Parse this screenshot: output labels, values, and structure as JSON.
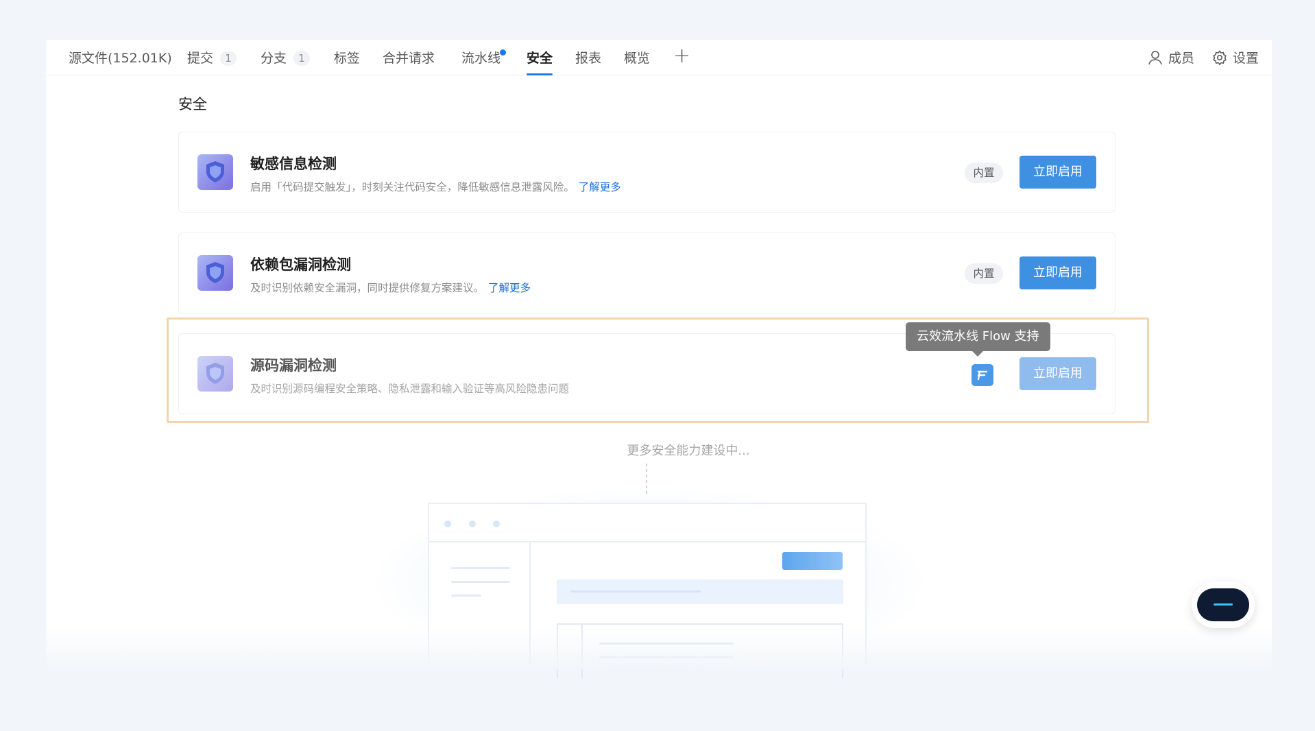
{
  "tabs": [
    {
      "label": "源文件(152.01K)",
      "badge": null,
      "active": false
    },
    {
      "label": "提交",
      "badge": "1",
      "active": false
    },
    {
      "label": "分支",
      "badge": "1",
      "active": false
    },
    {
      "label": "标签",
      "badge": null,
      "active": false
    },
    {
      "label": "合并请求",
      "badge": null,
      "active": false
    },
    {
      "label": "流水线",
      "badge": null,
      "active": false,
      "dot": true
    },
    {
      "label": "安全",
      "badge": null,
      "active": true
    },
    {
      "label": "报表",
      "badge": null,
      "active": false
    },
    {
      "label": "概览",
      "badge": null,
      "active": false
    }
  ],
  "header_actions": {
    "members": "成员",
    "settings": "设置"
  },
  "section_title": "安全",
  "cards": [
    {
      "name": "敏感信息检测",
      "desc": "启用「代码提交触发」，时刻关注代码安全，降低敏感信息泄露风险。",
      "link": "了解更多",
      "tag": "内置",
      "button": "立即启用"
    },
    {
      "name": "依赖包漏洞检测",
      "desc": "及时识别依赖安全漏洞，同时提供修复方案建议。",
      "link": "了解更多",
      "tag": "内置",
      "button": "立即启用"
    },
    {
      "name": "源码漏洞检测",
      "desc": "及时识别源码编程安全策略、隐私泄露和输入验证等高风险隐患问题",
      "link": null,
      "tag": null,
      "button": "立即启用"
    }
  ],
  "tooltip": "云效流水线 Flow 支持",
  "more_text": "更多安全能力建设中...",
  "colors": {
    "accent": "#1b7cf2",
    "button": "#3e90e3",
    "highlight_border": "#f4d4ae"
  }
}
